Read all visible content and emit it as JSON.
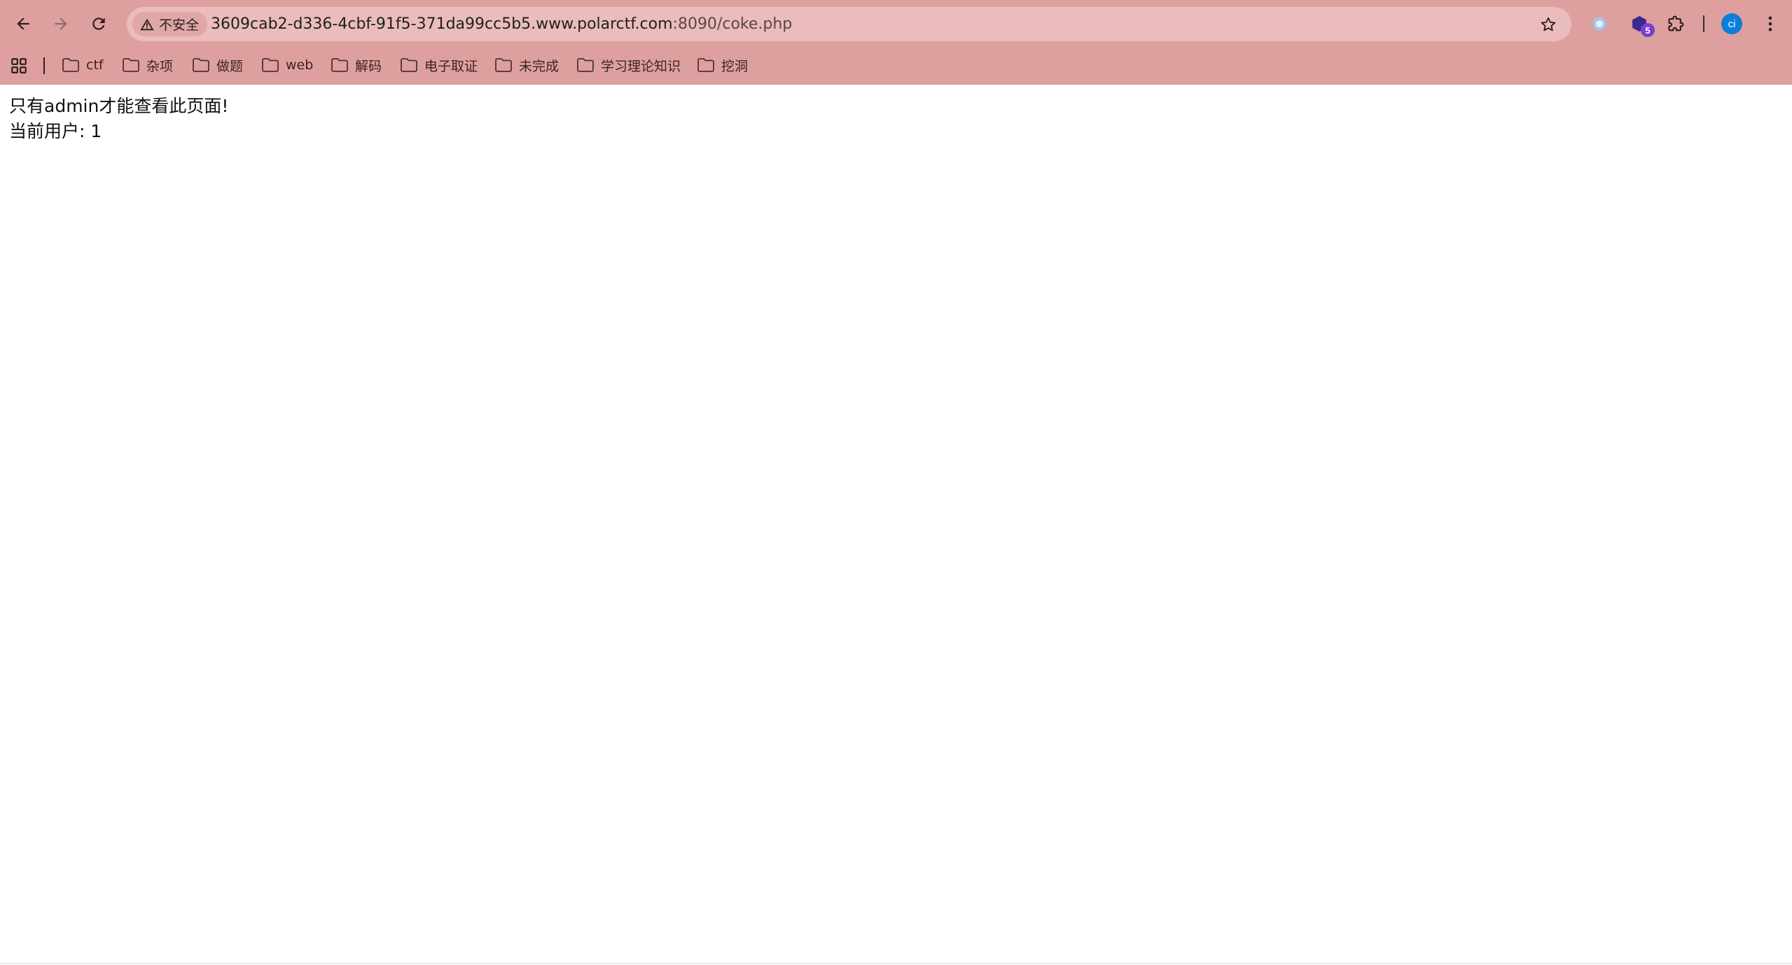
{
  "browser": {
    "security_label": "不安全",
    "url_host": "3609cab2-d336-4cbf-91f5-371da99cc5b5.www.polarctf.com",
    "url_path": ":8090/coke.php",
    "extension_badge_count": "5",
    "profile_initials": "ci",
    "icons": {
      "back": "back-arrow-icon",
      "forward": "forward-arrow-icon",
      "reload": "reload-icon",
      "warning": "warning-triangle-icon",
      "star": "star-icon",
      "extensions": "puzzle-icon",
      "menu": "kebab-menu-icon",
      "apps": "apps-grid-icon",
      "folder": "folder-icon"
    },
    "colors": {
      "frame": "#dea09e",
      "omnibox": "#eabcbb",
      "avatar": "#0b7fd8",
      "badge": "#7a3fd1"
    }
  },
  "bookmarks": [
    {
      "label": "ctf"
    },
    {
      "label": "杂项"
    },
    {
      "label": "做题"
    },
    {
      "label": "web"
    },
    {
      "label": "解码"
    },
    {
      "label": "电子取证"
    },
    {
      "label": "未完成"
    },
    {
      "label": "学习理论知识"
    },
    {
      "label": "挖洞"
    }
  ],
  "page": {
    "line1": "只有admin才能查看此页面!",
    "line2": "当前用户: 1"
  }
}
